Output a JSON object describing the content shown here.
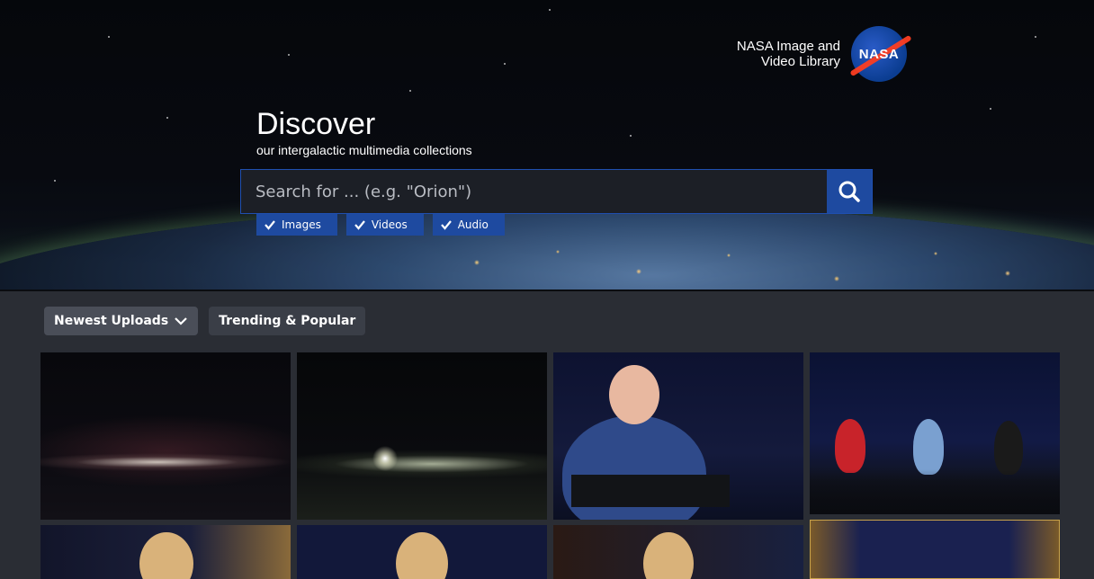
{
  "brand": {
    "line1": "NASA Image and",
    "line2": "Video Library",
    "logo_text": "NASA"
  },
  "hero": {
    "title": "Discover",
    "subtitle": "our intergalactic multimedia collections"
  },
  "search": {
    "placeholder": "Search for ... (e.g. \"Orion\")",
    "button_icon": "search-icon"
  },
  "filters": [
    {
      "label": "Images",
      "checked": true
    },
    {
      "label": "Videos",
      "checked": true
    },
    {
      "label": "Audio",
      "checked": true
    }
  ],
  "tabs": [
    {
      "label": "Newest Uploads",
      "active": true,
      "icon": "chevron-down-icon"
    },
    {
      "label": "Trending & Popular",
      "active": false
    }
  ],
  "colors": {
    "accent_blue": "#1e4aa0",
    "page_bg": "#2a2d34",
    "nasa_red": "#fc3d21"
  }
}
